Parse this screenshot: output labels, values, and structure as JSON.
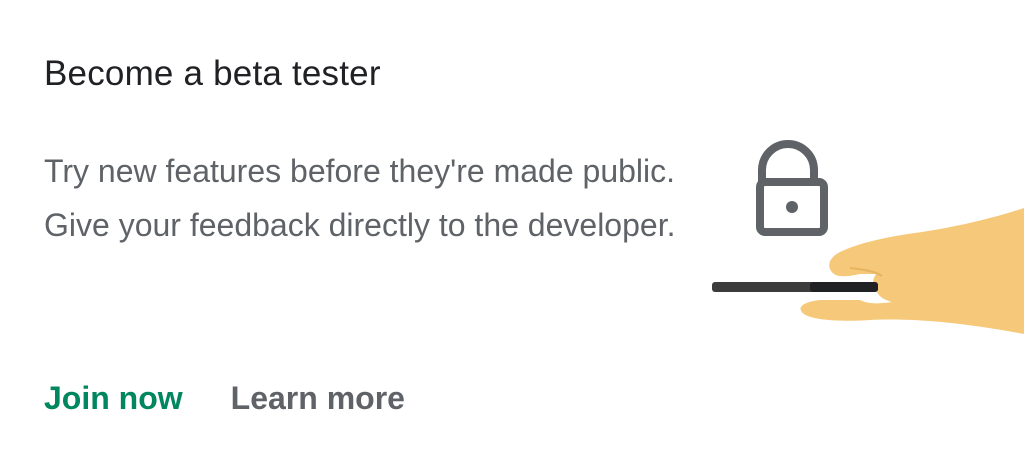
{
  "card": {
    "title": "Become a beta tester",
    "description": "Try new features before they're made public. Give your feedback directly to the developer."
  },
  "actions": {
    "join_label": "Join now",
    "learn_label": "Learn more"
  },
  "colors": {
    "accent_green": "#01875f",
    "text_primary": "#202124",
    "text_secondary": "#5f6368",
    "hand_fill": "#f6c97a",
    "lock_gray": "#5f6368"
  },
  "icons": [
    "unlock-icon",
    "hand-holding-phone-illustration"
  ]
}
